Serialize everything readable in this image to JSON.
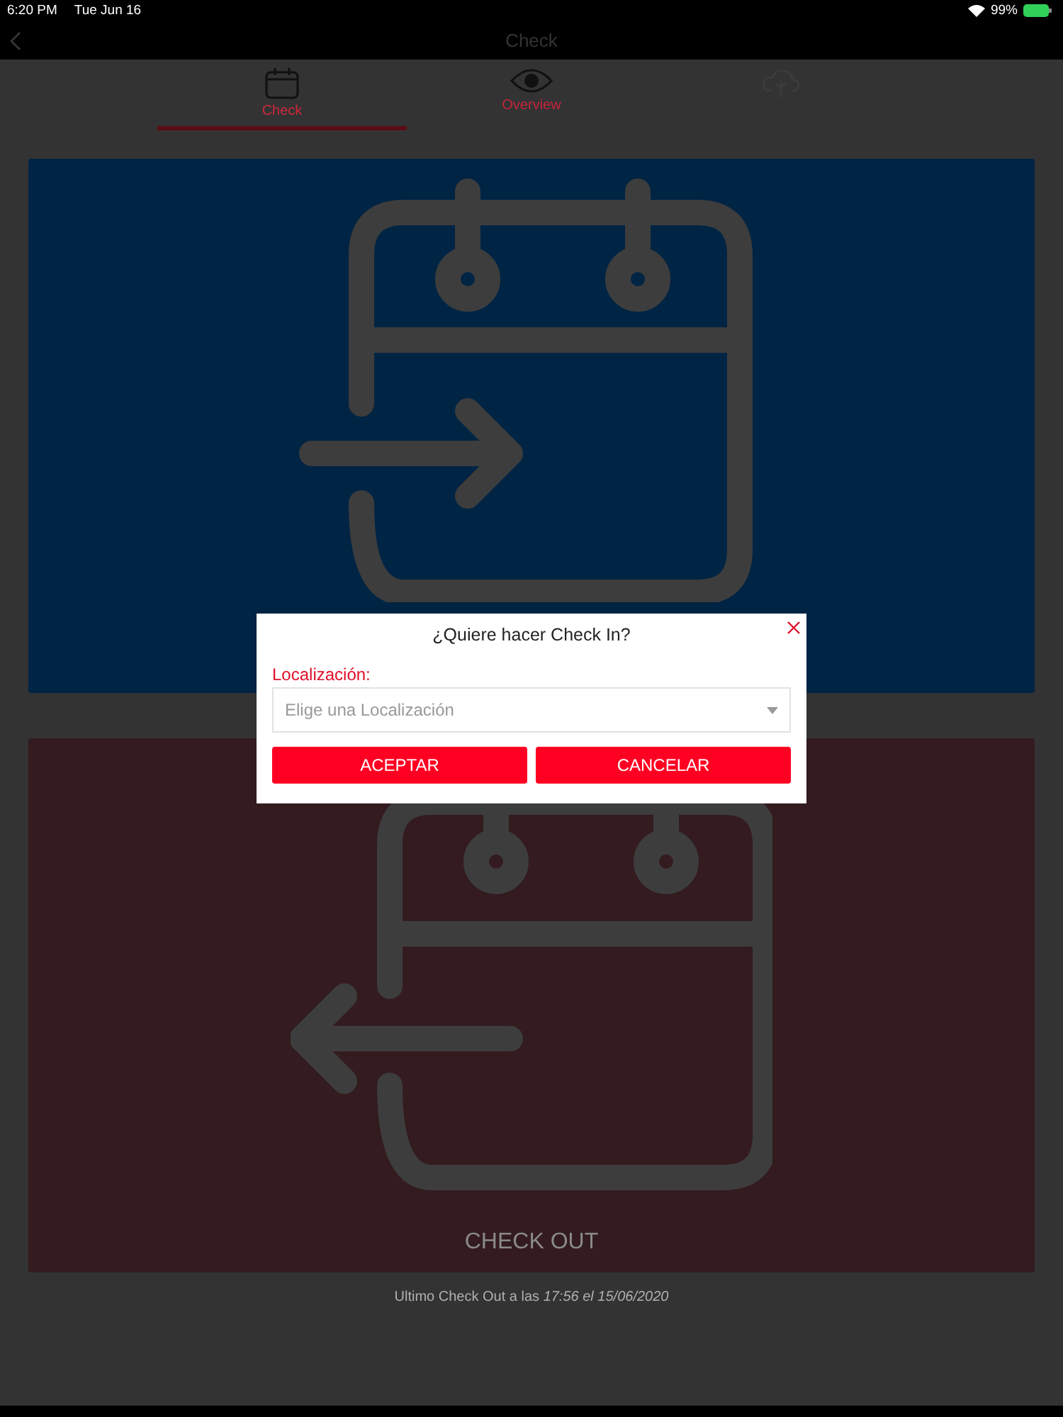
{
  "status_bar": {
    "time": "6:20 PM",
    "date": "Tue Jun 16",
    "battery": "99%"
  },
  "nav_bar": {
    "title": "Check"
  },
  "tabs": [
    {
      "kind": "calendar",
      "label": "Check",
      "selected": true
    },
    {
      "kind": "eye",
      "label": "Overview",
      "selected": false
    },
    {
      "kind": "cloud",
      "selected": false
    }
  ],
  "cards": [
    {
      "kind": "check_in"
    },
    {
      "kind": "check_out",
      "label": "CHECK OUT"
    }
  ],
  "footer": "Ultimo Check Out a las *17:56 el 15/06/2020*",
  "dialog": {
    "title": "¿Quiere hacer Check In?",
    "field_label": "Localización:",
    "placeholder": "Elige una Localización",
    "buttons": [
      "ACEPTAR",
      "CANCELAR"
    ]
  }
}
